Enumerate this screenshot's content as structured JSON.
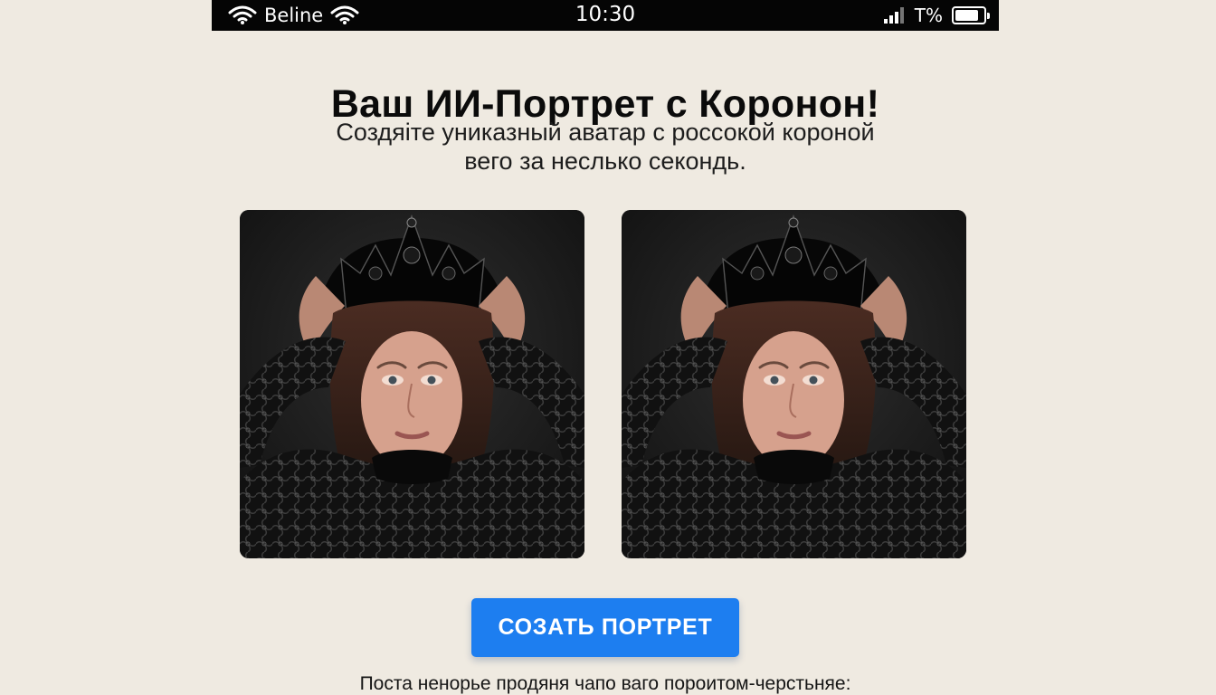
{
  "status_bar": {
    "carrier": "Beline",
    "time": "10:30",
    "battery_text": "T%",
    "icons": [
      "wifi-icon",
      "wifi-icon",
      "signal-icon",
      "battery-icon"
    ]
  },
  "header": {
    "title": "Ваш ИИ-Портрет с Коронон!",
    "subtitle_line1": "Создяіте униказный аватар с россокой короной",
    "subtitle_line2": "вего за несль­ко секондь."
  },
  "portraits": [
    {
      "content": "woman wearing black crown",
      "icon": "portrait-image"
    },
    {
      "content": "woman wearing black crown",
      "icon": "portrait-image"
    }
  ],
  "actions": {
    "create_label": "СОЗАТЬ ПОРТРЕТ",
    "accent_color": "#1d7ef0"
  },
  "footer": {
    "text": "Поста ненорье продяня чапо ваго пороитом-черстьняе:"
  }
}
